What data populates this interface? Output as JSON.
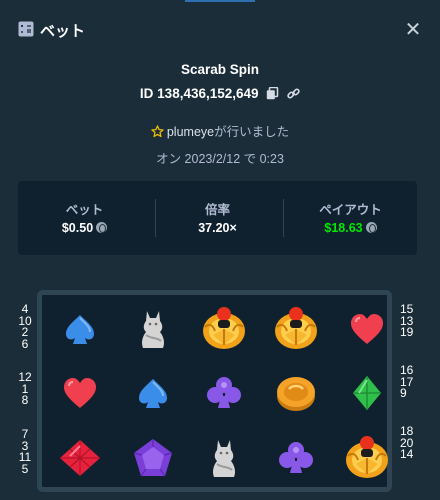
{
  "header": {
    "title": "ベット",
    "close_icon": "close-icon"
  },
  "bet": {
    "game_name": "Scarab Spin",
    "id_label": "ID 138,436,152,649",
    "user_name": "plumeye",
    "user_suffix": "が行いました",
    "datetime": "オン 2023/2/12 で 0:23"
  },
  "stats": {
    "bet_label": "ベット",
    "bet_value": "$0.50",
    "multiplier_label": "倍率",
    "multiplier_value": "37.20×",
    "payout_label": "ペイアウト",
    "payout_value": "$18.63",
    "payout_color": "#00e701",
    "currency_icon": "litecoin-icon"
  },
  "reels": {
    "rows": [
      [
        "blue-spade",
        "cat-statue",
        "scarab",
        "scarab",
        "red-heart"
      ],
      [
        "red-heart",
        "blue-spade",
        "purple-club",
        "gold-coin",
        "green-diamond"
      ],
      [
        "red-gem",
        "purple-gem",
        "cat-statue",
        "purple-club",
        "scarab"
      ]
    ],
    "left_paylines": [
      [
        "4",
        "10",
        "2",
        "6"
      ],
      [
        "12",
        "1",
        "8"
      ],
      [
        "7",
        "3",
        "11",
        "5"
      ]
    ],
    "right_paylines": [
      [
        "15",
        "13",
        "19"
      ],
      [
        "16",
        "17",
        "9"
      ],
      [
        "18",
        "20",
        "14"
      ]
    ]
  }
}
